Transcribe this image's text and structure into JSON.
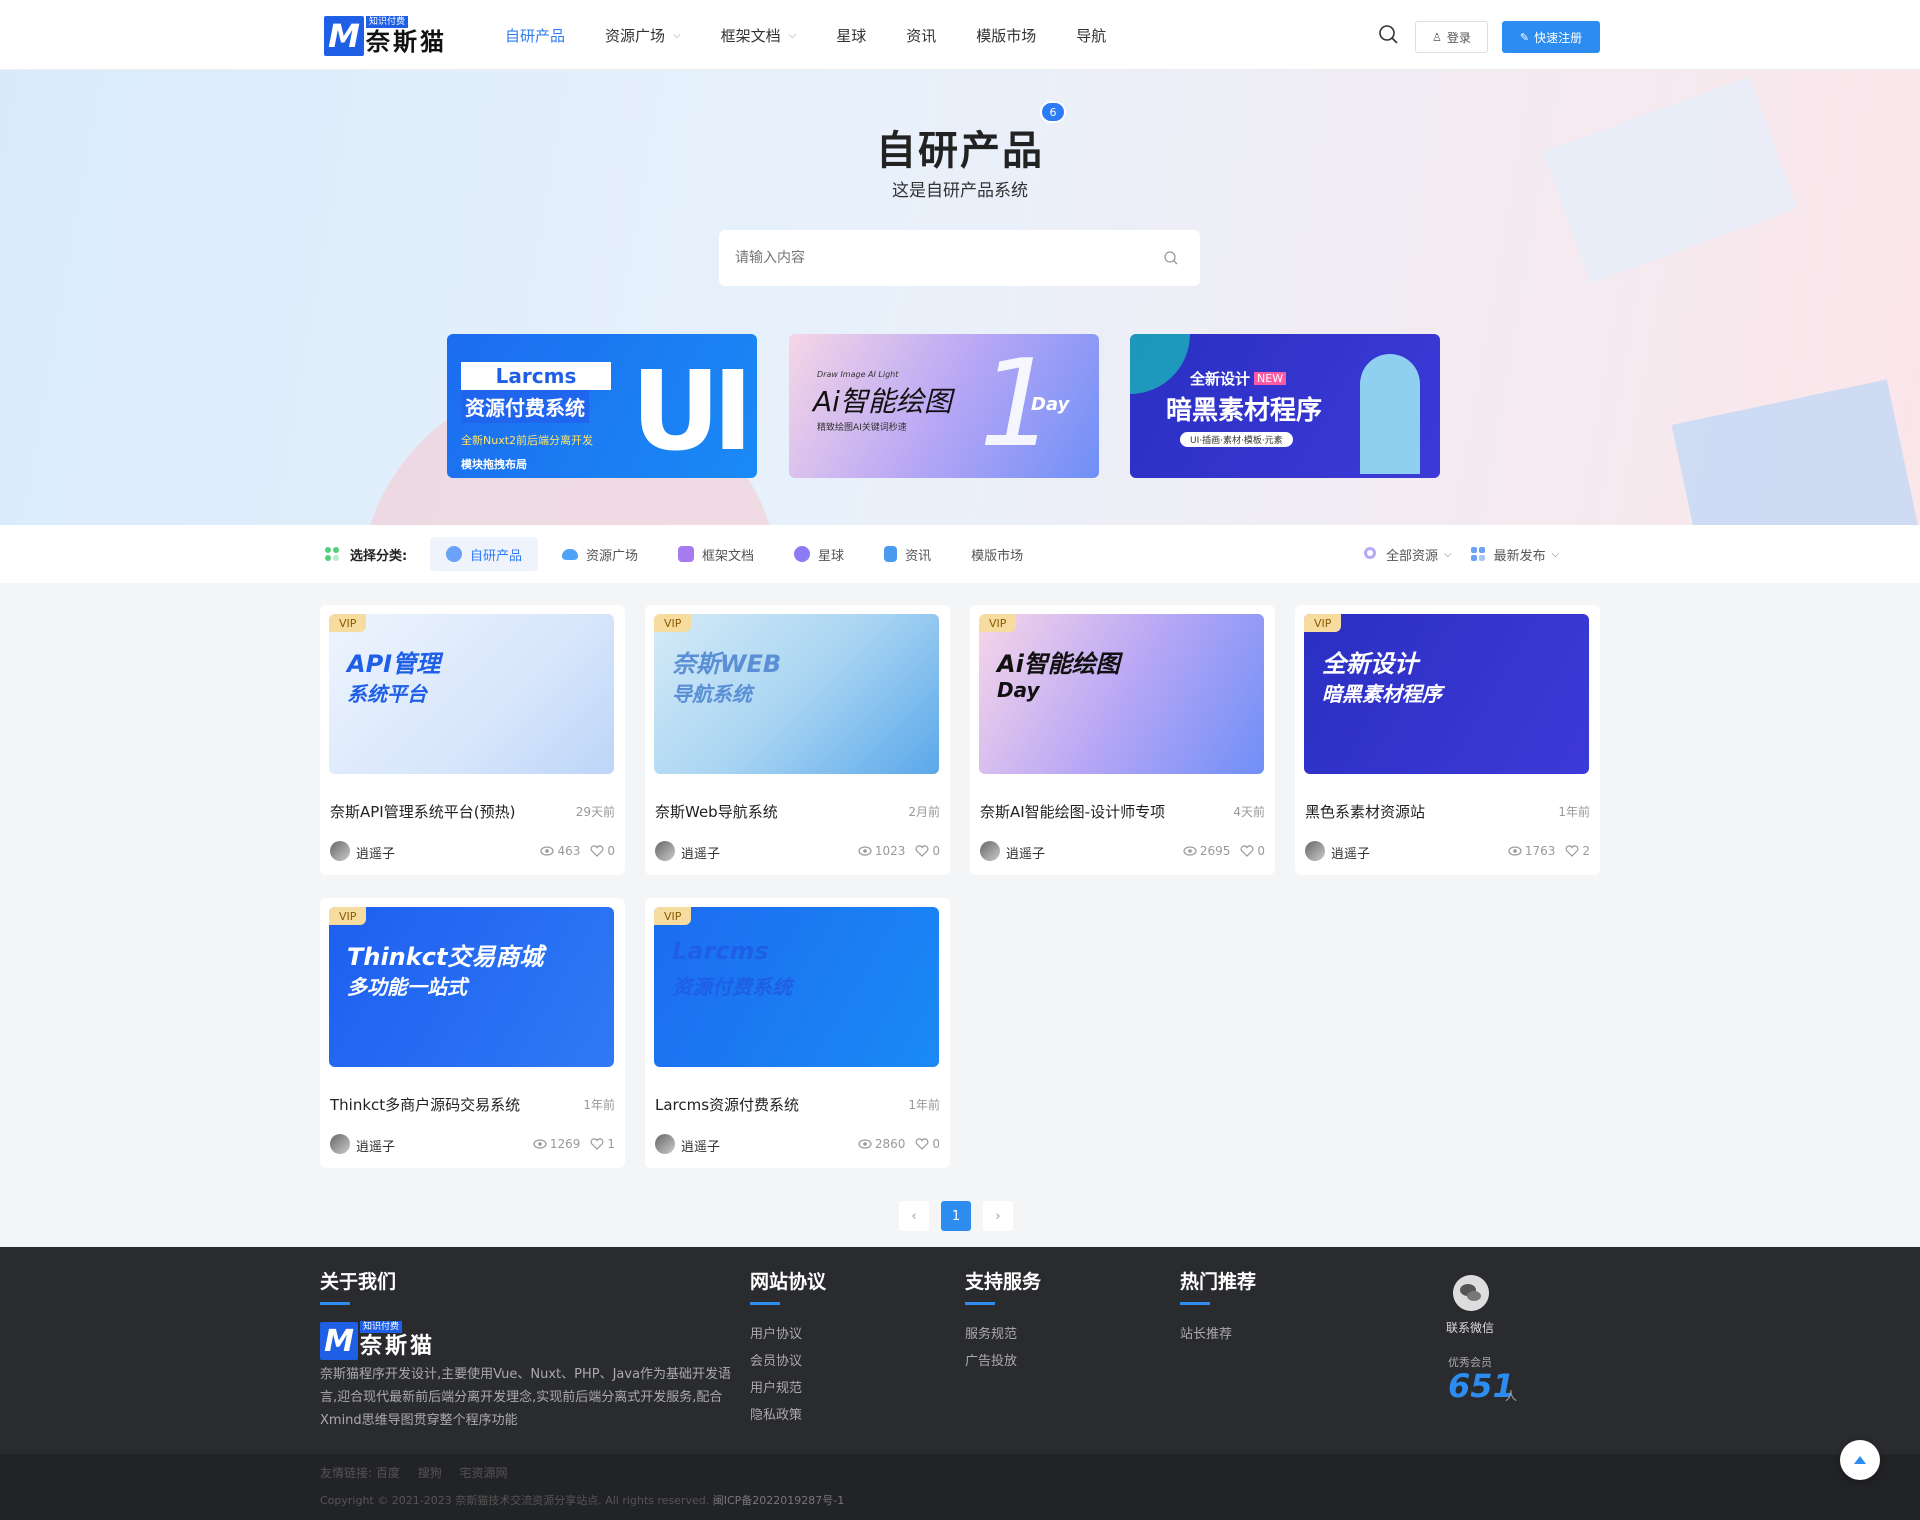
{
  "header": {
    "logo_tag": "知识付费",
    "logo_name": "奈斯猫",
    "nav": [
      {
        "label": "自研产品",
        "active": true,
        "dropdown": false
      },
      {
        "label": "资源广场",
        "active": false,
        "dropdown": true
      },
      {
        "label": "框架文档",
        "active": false,
        "dropdown": true
      },
      {
        "label": "星球",
        "active": false,
        "dropdown": false
      },
      {
        "label": "资讯",
        "active": false,
        "dropdown": false
      },
      {
        "label": "模版市场",
        "active": false,
        "dropdown": false
      },
      {
        "label": "导航",
        "active": false,
        "dropdown": false
      }
    ],
    "login_label": "登录",
    "register_label": "快速注册"
  },
  "hero": {
    "title": "自研产品",
    "badge": "6",
    "subtitle": "这是自研产品系统",
    "search_placeholder": "请输入内容",
    "banners": [
      {
        "line1": "Larcms",
        "line2": "资源付费系统",
        "line3": "全新Nuxt2前后端分离开发",
        "line4": "模块拖拽布局"
      },
      {
        "line1": "Draw Image AI Light",
        "line2": "Ai智能绘图",
        "line3": "精致绘图AI关键词秒速",
        "line4": "Day"
      },
      {
        "line1": "全新设计",
        "line2": "暗黑素材程序",
        "line3": "UI·插画·素材·模板·元素",
        "line4": "NEW"
      }
    ]
  },
  "categories": {
    "label": "选择分类:",
    "items": [
      {
        "label": "自研产品",
        "active": true,
        "color": "#6aa2f7"
      },
      {
        "label": "资源广场",
        "active": false,
        "color": "#4fa3f7"
      },
      {
        "label": "框架文档",
        "active": false,
        "color": "#a77bf0"
      },
      {
        "label": "星球",
        "active": false,
        "color": "#8b7cf6"
      },
      {
        "label": "资讯",
        "active": false,
        "color": "#4b9af0"
      },
      {
        "label": "模版市场",
        "active": false,
        "color": ""
      }
    ],
    "filters": [
      {
        "label": "全部资源"
      },
      {
        "label": "最新发布"
      }
    ]
  },
  "cards": [
    {
      "vip": "VIP",
      "title": "奈斯API管理系统平台(预热)",
      "time": "29天前",
      "author": "逍遥子",
      "views": "463",
      "likes": "0",
      "art": "api",
      "art_text": [
        "API管理",
        "系统平台"
      ]
    },
    {
      "vip": "VIP",
      "title": "奈斯Web导航系统",
      "time": "2月前",
      "author": "逍遥子",
      "views": "1023",
      "likes": "0",
      "art": "web",
      "art_text": [
        "奈斯WEB",
        "导航系统"
      ]
    },
    {
      "vip": "VIP",
      "title": "奈斯AI智能绘图-设计师专项",
      "time": "4天前",
      "author": "逍遥子",
      "views": "2695",
      "likes": "0",
      "art": "ai",
      "art_text": [
        "Ai智能绘图",
        "Day"
      ]
    },
    {
      "vip": "VIP",
      "title": "黑色系素材资源站",
      "time": "1年前",
      "author": "逍遥子",
      "views": "1763",
      "likes": "2",
      "art": "dark",
      "art_text": [
        "全新设计",
        "暗黑素材程序"
      ]
    },
    {
      "vip": "VIP",
      "title": "Thinkct多商户源码交易系统",
      "time": "1年前",
      "author": "逍遥子",
      "views": "1269",
      "likes": "1",
      "art": "thinkct",
      "art_text": [
        "Thinkct交易商城",
        "多功能一站式"
      ]
    },
    {
      "vip": "VIP",
      "title": "Larcms资源付费系统",
      "time": "1年前",
      "author": "逍遥子",
      "views": "2860",
      "likes": "0",
      "art": "larcms",
      "art_text": [
        "Larcms",
        "资源付费系统"
      ]
    }
  ],
  "pagination": {
    "prev": "‹",
    "current": "1",
    "next": "›"
  },
  "footer": {
    "about_title": "关于我们",
    "about_text": "奈斯猫程序开发设计,主要使用Vue、Nuxt、PHP、Java作为基础开发语言,迎合现代最新前后端分离开发理念,实现前后端分离式开发服务,配合Xmind思维导图贯穿整个程序功能",
    "col2_title": "网站协议",
    "col2_links": [
      "用户协议",
      "会员协议",
      "用户规范",
      "隐私政策"
    ],
    "col3_title": "支持服务",
    "col3_links": [
      "服务规范",
      "广告投放"
    ],
    "col4_title": "热门推荐",
    "col4_links": [
      "站长推荐"
    ],
    "wechat_label": "联系微信",
    "member_label": "优秀会员",
    "member_count": "651",
    "member_unit": "人",
    "friend_links": [
      "友情链接: 百度",
      "搜狗",
      "宅资源网"
    ],
    "copyright": "Copyright © 2021-2023 奈斯猫技术交流资源分享站点. All rights reserved.",
    "icp": "闽ICP备2022019287号-1"
  }
}
